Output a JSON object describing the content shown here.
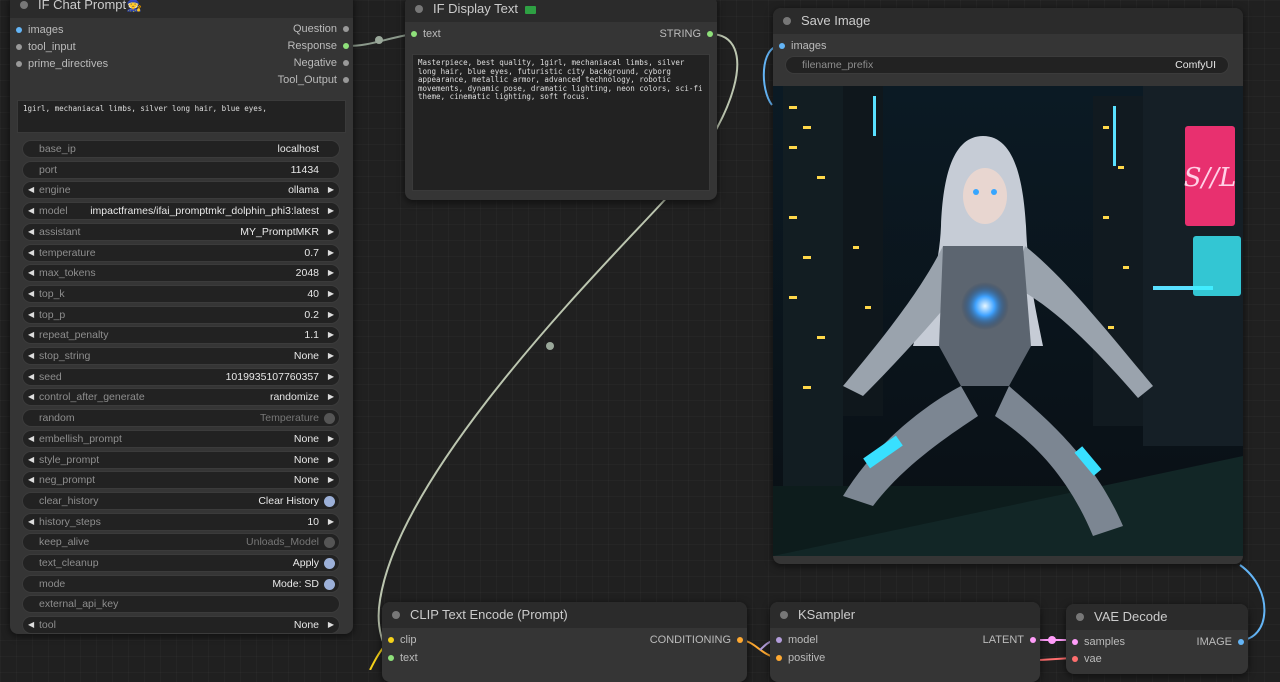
{
  "chat_node": {
    "title": "IF Chat Prompt🧙",
    "inputs": [
      "images",
      "tool_input",
      "prime_directives"
    ],
    "outputs": [
      "Question",
      "Response",
      "Negative",
      "Tool_Output"
    ],
    "prompt_text": "1girl, mechaniacal limbs, silver long hair, blue eyes,",
    "widgets": [
      {
        "label": "base_ip",
        "value": "localhost",
        "kind": "text"
      },
      {
        "label": "port",
        "value": "11434",
        "kind": "text"
      },
      {
        "label": "engine",
        "value": "ollama",
        "kind": "combo"
      },
      {
        "label": "model",
        "value": "impactframes/ifai_promptmkr_dolphin_phi3:latest",
        "kind": "combo"
      },
      {
        "label": "assistant",
        "value": "MY_PromptMKR",
        "kind": "combo"
      },
      {
        "label": "temperature",
        "value": "0.7",
        "kind": "number"
      },
      {
        "label": "max_tokens",
        "value": "2048",
        "kind": "number"
      },
      {
        "label": "top_k",
        "value": "40",
        "kind": "number"
      },
      {
        "label": "top_p",
        "value": "0.2",
        "kind": "number"
      },
      {
        "label": "repeat_penalty",
        "value": "1.1",
        "kind": "number"
      },
      {
        "label": "stop_string",
        "value": "None",
        "kind": "combo"
      },
      {
        "label": "seed",
        "value": "1019935107760357",
        "kind": "number"
      },
      {
        "label": "control_after_generate",
        "value": "randomize",
        "kind": "combo"
      },
      {
        "label": "random",
        "value": "Temperature",
        "kind": "toggle-off"
      },
      {
        "label": "embellish_prompt",
        "value": "None",
        "kind": "combo"
      },
      {
        "label": "style_prompt",
        "value": "None",
        "kind": "combo"
      },
      {
        "label": "neg_prompt",
        "value": "None",
        "kind": "combo"
      },
      {
        "label": "clear_history",
        "value": "Clear History",
        "kind": "toggle-on"
      },
      {
        "label": "history_steps",
        "value": "10",
        "kind": "number"
      },
      {
        "label": "keep_alive",
        "value": "Unloads_Model",
        "kind": "toggle-off"
      },
      {
        "label": "text_cleanup",
        "value": "Apply",
        "kind": "toggle-on"
      },
      {
        "label": "mode",
        "value": "Mode: SD",
        "kind": "toggle-on"
      },
      {
        "label": "external_api_key",
        "value": "",
        "kind": "text"
      },
      {
        "label": "tool",
        "value": "None",
        "kind": "combo"
      }
    ]
  },
  "display_node": {
    "title": "IF Display Text",
    "input": "text",
    "output": "STRING",
    "text": "Masterpiece, best quality, 1girl, mechaniacal limbs, silver long hair, blue eyes, futuristic city background, cyborg appearance, metallic armor, advanced technology, robotic movements, dynamic pose, dramatic lighting, neon colors, sci-fi theme, cinematic lighting, soft focus."
  },
  "save_node": {
    "title": "Save Image",
    "input": "images",
    "filename_label": "filename_prefix",
    "filename_value": "ComfyUI",
    "neon_sign_text": "S//L"
  },
  "clip_node": {
    "title": "CLIP Text Encode (Prompt)",
    "inputs": [
      "clip",
      "text"
    ],
    "output": "CONDITIONING"
  },
  "ksampler_node": {
    "title": "KSampler",
    "inputs": [
      "model",
      "positive"
    ],
    "output": "LATENT"
  },
  "vae_node": {
    "title": "VAE Decode",
    "inputs": [
      "samples",
      "vae"
    ],
    "output": "IMAGE"
  },
  "colors": {
    "image": "#64b5f6",
    "string": "#8ee07a",
    "clip": "#f5d21a",
    "conditioning": "#ffa931",
    "latent": "#ff9cf9",
    "vae": "#ff6e6e",
    "model": "#b39ddb",
    "gray": "#999999"
  }
}
